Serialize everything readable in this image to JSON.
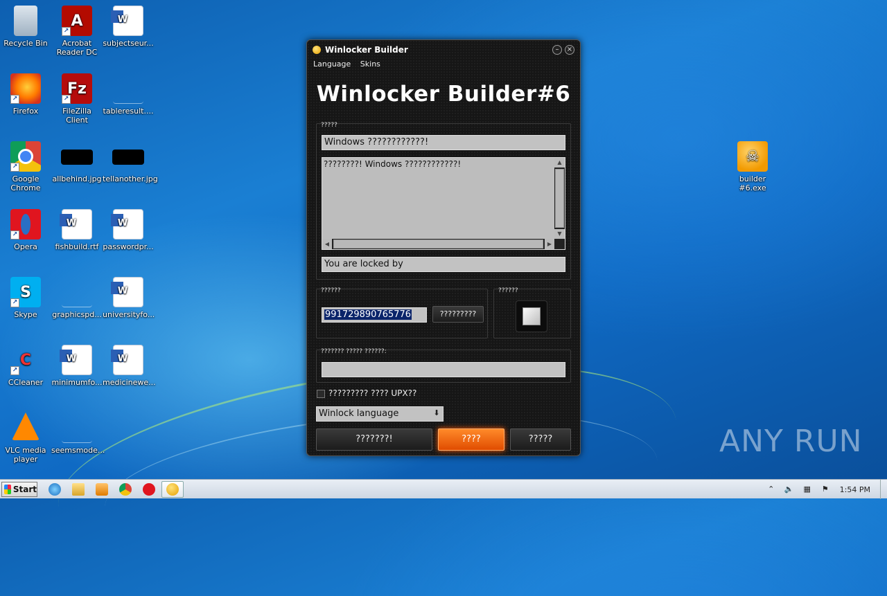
{
  "desktop": {
    "icons": [
      {
        "label": "Recycle Bin",
        "icon": "recycle-bin-icon"
      },
      {
        "label": "Acrobat Reader DC",
        "icon": "acrobat-icon"
      },
      {
        "label": "subjectseur...",
        "icon": "word-document-icon"
      },
      {
        "label": "Firefox",
        "icon": "firefox-icon"
      },
      {
        "label": "FileZilla Client",
        "icon": "filezilla-icon"
      },
      {
        "label": "tableresult....",
        "icon": "blank-file-icon"
      },
      {
        "label": "Google Chrome",
        "icon": "chrome-icon"
      },
      {
        "label": "allbehind.jpg",
        "icon": "image-thumbnail-icon"
      },
      {
        "label": "tellanother.jpg",
        "icon": "image-thumbnail-icon"
      },
      {
        "label": "Opera",
        "icon": "opera-icon"
      },
      {
        "label": "fishbuild.rtf",
        "icon": "word-document-icon"
      },
      {
        "label": "passwordpr...",
        "icon": "word-document-icon"
      },
      {
        "label": "Skype",
        "icon": "skype-icon"
      },
      {
        "label": "graphicspd...",
        "icon": "blank-file-icon"
      },
      {
        "label": "universityfo...",
        "icon": "word-document-icon"
      },
      {
        "label": "CCleaner",
        "icon": "ccleaner-icon"
      },
      {
        "label": "minimumfo...",
        "icon": "word-document-icon"
      },
      {
        "label": "medicinewe...",
        "icon": "word-document-icon"
      },
      {
        "label": "VLC media player",
        "icon": "vlc-icon"
      },
      {
        "label": "seemsmode...",
        "icon": "blank-file-icon"
      },
      {
        "label": "builder #6.exe",
        "icon": "skull-exe-icon"
      }
    ]
  },
  "window": {
    "title": "Winlocker Builder",
    "minimize_label": "–",
    "close_label": "×",
    "menu": [
      "Language",
      "Skins"
    ],
    "heading": "Winlocker Builder#6",
    "text_group": {
      "label": "?????",
      "title_value": "Windows ????????????!",
      "message_value": "????????! Windows ????????????!",
      "footer_value": "You are locked by"
    },
    "code_group": {
      "label": "??????",
      "code_value": "991729890765776",
      "generate_button": "?????????"
    },
    "icon_group": {
      "label": "??????"
    },
    "path_group": {
      "label": "??????? ????? ??????:",
      "path_value": ""
    },
    "upx_checkbox": {
      "label": "????????? ???? UPX??",
      "checked": false
    },
    "language_select": {
      "value": "Winlock language"
    },
    "buttons": {
      "left": "???????!",
      "center": "????",
      "right": "?????"
    },
    "accent_color": "#ff6a00"
  },
  "taskbar": {
    "start_label": "Start",
    "clock": "1:54 PM"
  },
  "watermark": "ANY RUN"
}
